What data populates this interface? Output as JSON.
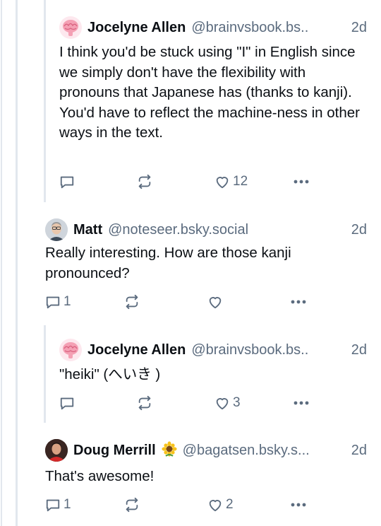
{
  "posts": [
    {
      "display_name": "Jocelyne Allen",
      "handle": "@brainvsbook.bs..",
      "time": "2d",
      "avatar": "brain-icon",
      "text": "I think you'd be stuck using \"I\" in English since we simply don't have the flexibility with pronouns that Japanese has (thanks to kanji). You'd have to reflect the machine-ness in other ways in the text.",
      "replies": "",
      "reposts": "",
      "likes": "12"
    },
    {
      "display_name": "Matt",
      "handle": "@noteseer.bsky.social",
      "time": "2d",
      "avatar": "person-photo",
      "text": "Really interesting. How are those kanji pronounced?",
      "replies": "1",
      "reposts": "",
      "likes": ""
    },
    {
      "display_name": "Jocelyne Allen",
      "handle": "@brainvsbook.bs..",
      "time": "2d",
      "avatar": "brain-icon",
      "text": "\"heiki\" (へいき )",
      "replies": "",
      "reposts": "",
      "likes": "3"
    },
    {
      "display_name": "Doug Merrill",
      "name_emoji": "sunflower-icon",
      "handle": "@bagatsen.bsky.s...",
      "time": "2d",
      "avatar": "person-photo",
      "text": "That's awesome!",
      "replies": "1",
      "reposts": "",
      "likes": "2"
    }
  ],
  "colors": {
    "text": "#0b0f14",
    "muted": "#5b6b7e",
    "thread_line": "#e2e7ee",
    "brain_pink": "#f4a0b4"
  }
}
